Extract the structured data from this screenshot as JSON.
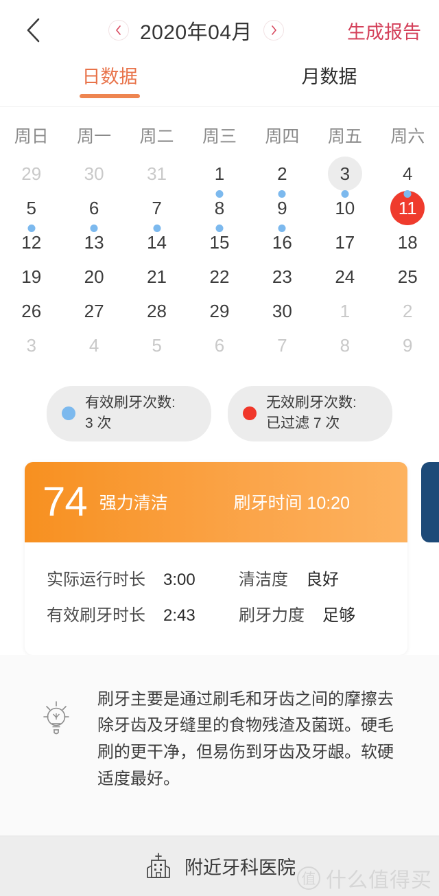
{
  "header": {
    "back_icon": "chevron-left-icon",
    "prev_month_icon": "chevron-left-icon",
    "next_month_icon": "chevron-right-icon",
    "month_label": "2020年04月",
    "report_button": "生成报告",
    "report_color": "#d4405a"
  },
  "tabs": [
    {
      "label": "日数据",
      "active": true
    },
    {
      "label": "月数据",
      "active": false
    }
  ],
  "calendar": {
    "weekdays": [
      "周日",
      "周一",
      "周二",
      "周三",
      "周四",
      "周五",
      "周六"
    ],
    "accent_selected": "#ef3b2d",
    "accent_today": "#ececec",
    "dot_color": "#7cb9ee",
    "weeks": [
      [
        {
          "num": "29",
          "muted": true,
          "dot": false,
          "state": "none"
        },
        {
          "num": "30",
          "muted": true,
          "dot": false,
          "state": "none"
        },
        {
          "num": "31",
          "muted": true,
          "dot": false,
          "state": "none"
        },
        {
          "num": "1",
          "muted": false,
          "dot": true,
          "state": "none"
        },
        {
          "num": "2",
          "muted": false,
          "dot": true,
          "state": "none"
        },
        {
          "num": "3",
          "muted": false,
          "dot": true,
          "state": "today"
        },
        {
          "num": "4",
          "muted": false,
          "dot": true,
          "state": "none"
        }
      ],
      [
        {
          "num": "5",
          "muted": false,
          "dot": true,
          "state": "none"
        },
        {
          "num": "6",
          "muted": false,
          "dot": true,
          "state": "none"
        },
        {
          "num": "7",
          "muted": false,
          "dot": true,
          "state": "none"
        },
        {
          "num": "8",
          "muted": false,
          "dot": true,
          "state": "none"
        },
        {
          "num": "9",
          "muted": false,
          "dot": true,
          "state": "none"
        },
        {
          "num": "10",
          "muted": false,
          "dot": false,
          "state": "none"
        },
        {
          "num": "11",
          "muted": false,
          "dot": false,
          "state": "selected"
        }
      ],
      [
        {
          "num": "12",
          "muted": false,
          "dot": false,
          "state": "none"
        },
        {
          "num": "13",
          "muted": false,
          "dot": false,
          "state": "none"
        },
        {
          "num": "14",
          "muted": false,
          "dot": false,
          "state": "none"
        },
        {
          "num": "15",
          "muted": false,
          "dot": false,
          "state": "none"
        },
        {
          "num": "16",
          "muted": false,
          "dot": false,
          "state": "none"
        },
        {
          "num": "17",
          "muted": false,
          "dot": false,
          "state": "none"
        },
        {
          "num": "18",
          "muted": false,
          "dot": false,
          "state": "none"
        }
      ],
      [
        {
          "num": "19",
          "muted": false,
          "dot": false,
          "state": "none"
        },
        {
          "num": "20",
          "muted": false,
          "dot": false,
          "state": "none"
        },
        {
          "num": "21",
          "muted": false,
          "dot": false,
          "state": "none"
        },
        {
          "num": "22",
          "muted": false,
          "dot": false,
          "state": "none"
        },
        {
          "num": "23",
          "muted": false,
          "dot": false,
          "state": "none"
        },
        {
          "num": "24",
          "muted": false,
          "dot": false,
          "state": "none"
        },
        {
          "num": "25",
          "muted": false,
          "dot": false,
          "state": "none"
        }
      ],
      [
        {
          "num": "26",
          "muted": false,
          "dot": false,
          "state": "none"
        },
        {
          "num": "27",
          "muted": false,
          "dot": false,
          "state": "none"
        },
        {
          "num": "28",
          "muted": false,
          "dot": false,
          "state": "none"
        },
        {
          "num": "29",
          "muted": false,
          "dot": false,
          "state": "none"
        },
        {
          "num": "30",
          "muted": false,
          "dot": false,
          "state": "none"
        },
        {
          "num": "1",
          "muted": true,
          "dot": false,
          "state": "none"
        },
        {
          "num": "2",
          "muted": true,
          "dot": false,
          "state": "none"
        }
      ],
      [
        {
          "num": "3",
          "muted": true,
          "dot": false,
          "state": "none"
        },
        {
          "num": "4",
          "muted": true,
          "dot": false,
          "state": "none"
        },
        {
          "num": "5",
          "muted": true,
          "dot": false,
          "state": "none"
        },
        {
          "num": "6",
          "muted": true,
          "dot": false,
          "state": "none"
        },
        {
          "num": "7",
          "muted": true,
          "dot": false,
          "state": "none"
        },
        {
          "num": "8",
          "muted": true,
          "dot": false,
          "state": "none"
        },
        {
          "num": "9",
          "muted": true,
          "dot": false,
          "state": "none"
        }
      ]
    ]
  },
  "summary": {
    "valid": {
      "title": "有效刷牙次数:",
      "value": "3 次",
      "dot_color": "#7cb9ee"
    },
    "invalid": {
      "title": "无效刷牙次数:",
      "value": "已过滤 7 次",
      "dot_color": "#f0372a"
    }
  },
  "record": {
    "score": "74",
    "mode": "强力清洁",
    "brush_time": "刷牙时间 10:20",
    "header_color_start": "#f79020",
    "header_color_end": "#fdb25f",
    "details": [
      {
        "label": "实际运行时长",
        "value": "3:00"
      },
      {
        "label": "清洁度",
        "value": "良好"
      },
      {
        "label": "有效刷牙时长",
        "value": "2:43"
      },
      {
        "label": "刷牙力度",
        "value": "足够"
      }
    ],
    "next_card_color": "#1d4a78"
  },
  "tip": {
    "icon": "lightbulb-icon",
    "text": "刷牙主要是通过刷毛和牙齿之间的摩擦去除牙齿及牙缝里的食物残渣及菌斑。硬毛刷的更干净，但易伤到牙齿及牙龈。软硬适度最好。"
  },
  "bottom": {
    "icon": "hospital-icon",
    "label": "附近牙科医院"
  },
  "watermark": {
    "badge": "值",
    "text": "什么值得买"
  }
}
